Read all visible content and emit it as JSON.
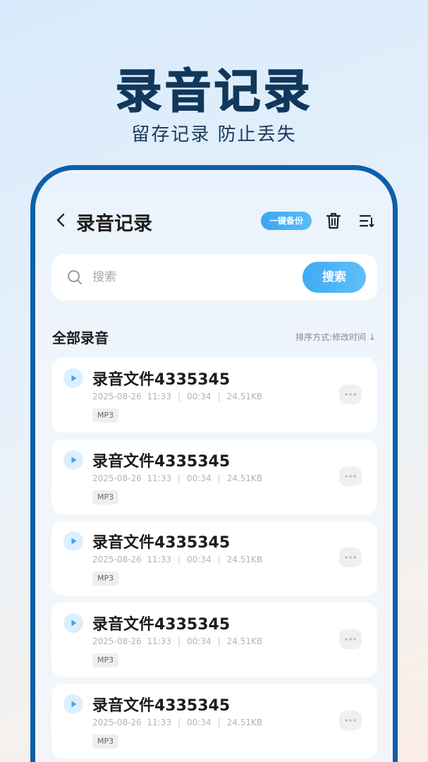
{
  "hero": {
    "title": "录音记录",
    "subtitle": "留存记录 防止丢失"
  },
  "header": {
    "title": "录音记录",
    "backup_label": "一键备份"
  },
  "search": {
    "placeholder": "搜索",
    "button_label": "搜索"
  },
  "section": {
    "title": "全部录音",
    "sort_label": "排序方式:修改时间 ↓"
  },
  "recordings": [
    {
      "name": "录音文件4335345",
      "date": "2025-08-26",
      "time": "11:33",
      "duration": "00:34",
      "size": "24.51KB",
      "format": "MP3"
    },
    {
      "name": "录音文件4335345",
      "date": "2025-08-26",
      "time": "11:33",
      "duration": "00:34",
      "size": "24.51KB",
      "format": "MP3"
    },
    {
      "name": "录音文件4335345",
      "date": "2025-08-26",
      "time": "11:33",
      "duration": "00:34",
      "size": "24.51KB",
      "format": "MP3"
    },
    {
      "name": "录音文件4335345",
      "date": "2025-08-26",
      "time": "11:33",
      "duration": "00:34",
      "size": "24.51KB",
      "format": "MP3"
    },
    {
      "name": "录音文件4335345",
      "date": "2025-08-26",
      "time": "11:33",
      "duration": "00:34",
      "size": "24.51KB",
      "format": "MP3"
    }
  ],
  "icons": {
    "back": "chevron-left-icon",
    "trash": "trash-icon",
    "sort": "sort-icon",
    "search": "search-icon",
    "play": "play-icon",
    "more": "more-icon"
  },
  "colors": {
    "accent": "#3aa6f3",
    "frame": "#0f5fa8",
    "title": "#11385c"
  }
}
